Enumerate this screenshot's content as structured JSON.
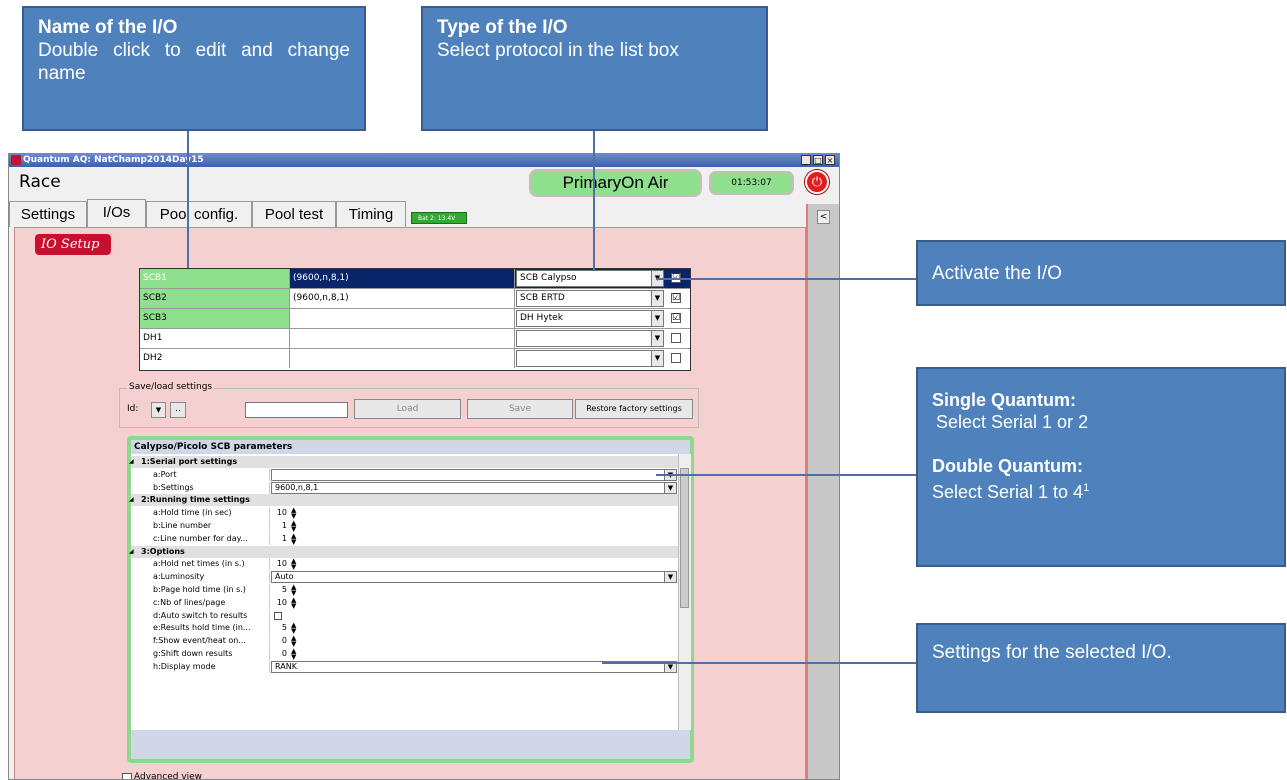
{
  "callouts": {
    "name": {
      "title": "Name of the I/O",
      "text": "Double click to edit and change name"
    },
    "type": {
      "title": "Type of the I/O",
      "text": "Select protocol in the list box"
    },
    "activate": {
      "text": "Activate the I/O"
    },
    "serial": {
      "single_title": "Single Quantum:",
      "single_text": "Select Serial 1 or 2",
      "double_title": "Double Quantum:",
      "double_text": "Select Serial 1 to 4",
      "footnote": "1"
    },
    "settings": {
      "text": "Settings for the selected I/O."
    }
  },
  "window": {
    "title": "Quantum AQ: NatChamp2014Day15",
    "min": "_",
    "max": "□",
    "close": "×"
  },
  "header": {
    "race": "Race",
    "status": "PrimaryOn Air",
    "clock": "01:53:07",
    "power_icon": "power-icon"
  },
  "tabs": [
    "Settings",
    "I/Os",
    "Pool config.",
    "Pool test",
    "Timing"
  ],
  "battery": "Bat 2: 13.4V",
  "collapse_label": "<",
  "section_title": "IO Setup",
  "io_rows": [
    {
      "name": "SCB1",
      "settings": "(9600,n,8,1)",
      "protocol": "SCB Calypso",
      "checked": "☑"
    },
    {
      "name": "SCB2",
      "settings": "(9600,n,8,1)",
      "protocol": "SCB ERTD",
      "checked": "☑"
    },
    {
      "name": "SCB3",
      "settings": "",
      "protocol": "DH Hytek",
      "checked": "☑"
    },
    {
      "name": "DH1",
      "settings": "",
      "protocol": "",
      "checked": ""
    },
    {
      "name": "DH2",
      "settings": "",
      "protocol": "",
      "checked": ""
    }
  ],
  "save_load": {
    "legend": "Save/load settings",
    "id_label": "Id:",
    "dots": "..",
    "load": "Load",
    "save": "Save",
    "restore": "Restore factory settings"
  },
  "params": {
    "header": "Calypso/Picolo SCB parameters",
    "rows": [
      {
        "kind": "sec",
        "label": "1:Serial port settings"
      },
      {
        "kind": "combo",
        "label": "a:Port",
        "value": ""
      },
      {
        "kind": "combo",
        "label": "b:Settings",
        "value": "9600,n,8,1"
      },
      {
        "kind": "sec",
        "label": "2:Running time settings"
      },
      {
        "kind": "spin",
        "label": "a:Hold time (in sec)",
        "value": "10"
      },
      {
        "kind": "spin",
        "label": "b:Line number",
        "value": "1"
      },
      {
        "kind": "spin",
        "label": "c:Line number for day...",
        "value": "1"
      },
      {
        "kind": "sec",
        "label": "3:Options"
      },
      {
        "kind": "spin",
        "label": "a:Hold net times (in s.)",
        "value": "10"
      },
      {
        "kind": "combo",
        "label": "a:Luminosity",
        "value": "Auto"
      },
      {
        "kind": "spin",
        "label": "b:Page hold time (in s.)",
        "value": "5"
      },
      {
        "kind": "spin",
        "label": "c:Nb of lines/page",
        "value": "10"
      },
      {
        "kind": "check",
        "label": "d:Auto switch to results",
        "value": ""
      },
      {
        "kind": "spin",
        "label": "e:Results hold time (in...",
        "value": "5"
      },
      {
        "kind": "spin",
        "label": "f:Show event/heat on...",
        "value": "0"
      },
      {
        "kind": "spin",
        "label": "g:Shift down results",
        "value": "0"
      },
      {
        "kind": "combo",
        "label": "h:Display mode",
        "value": "RANK"
      }
    ]
  },
  "advanced_view": "Advanced view"
}
